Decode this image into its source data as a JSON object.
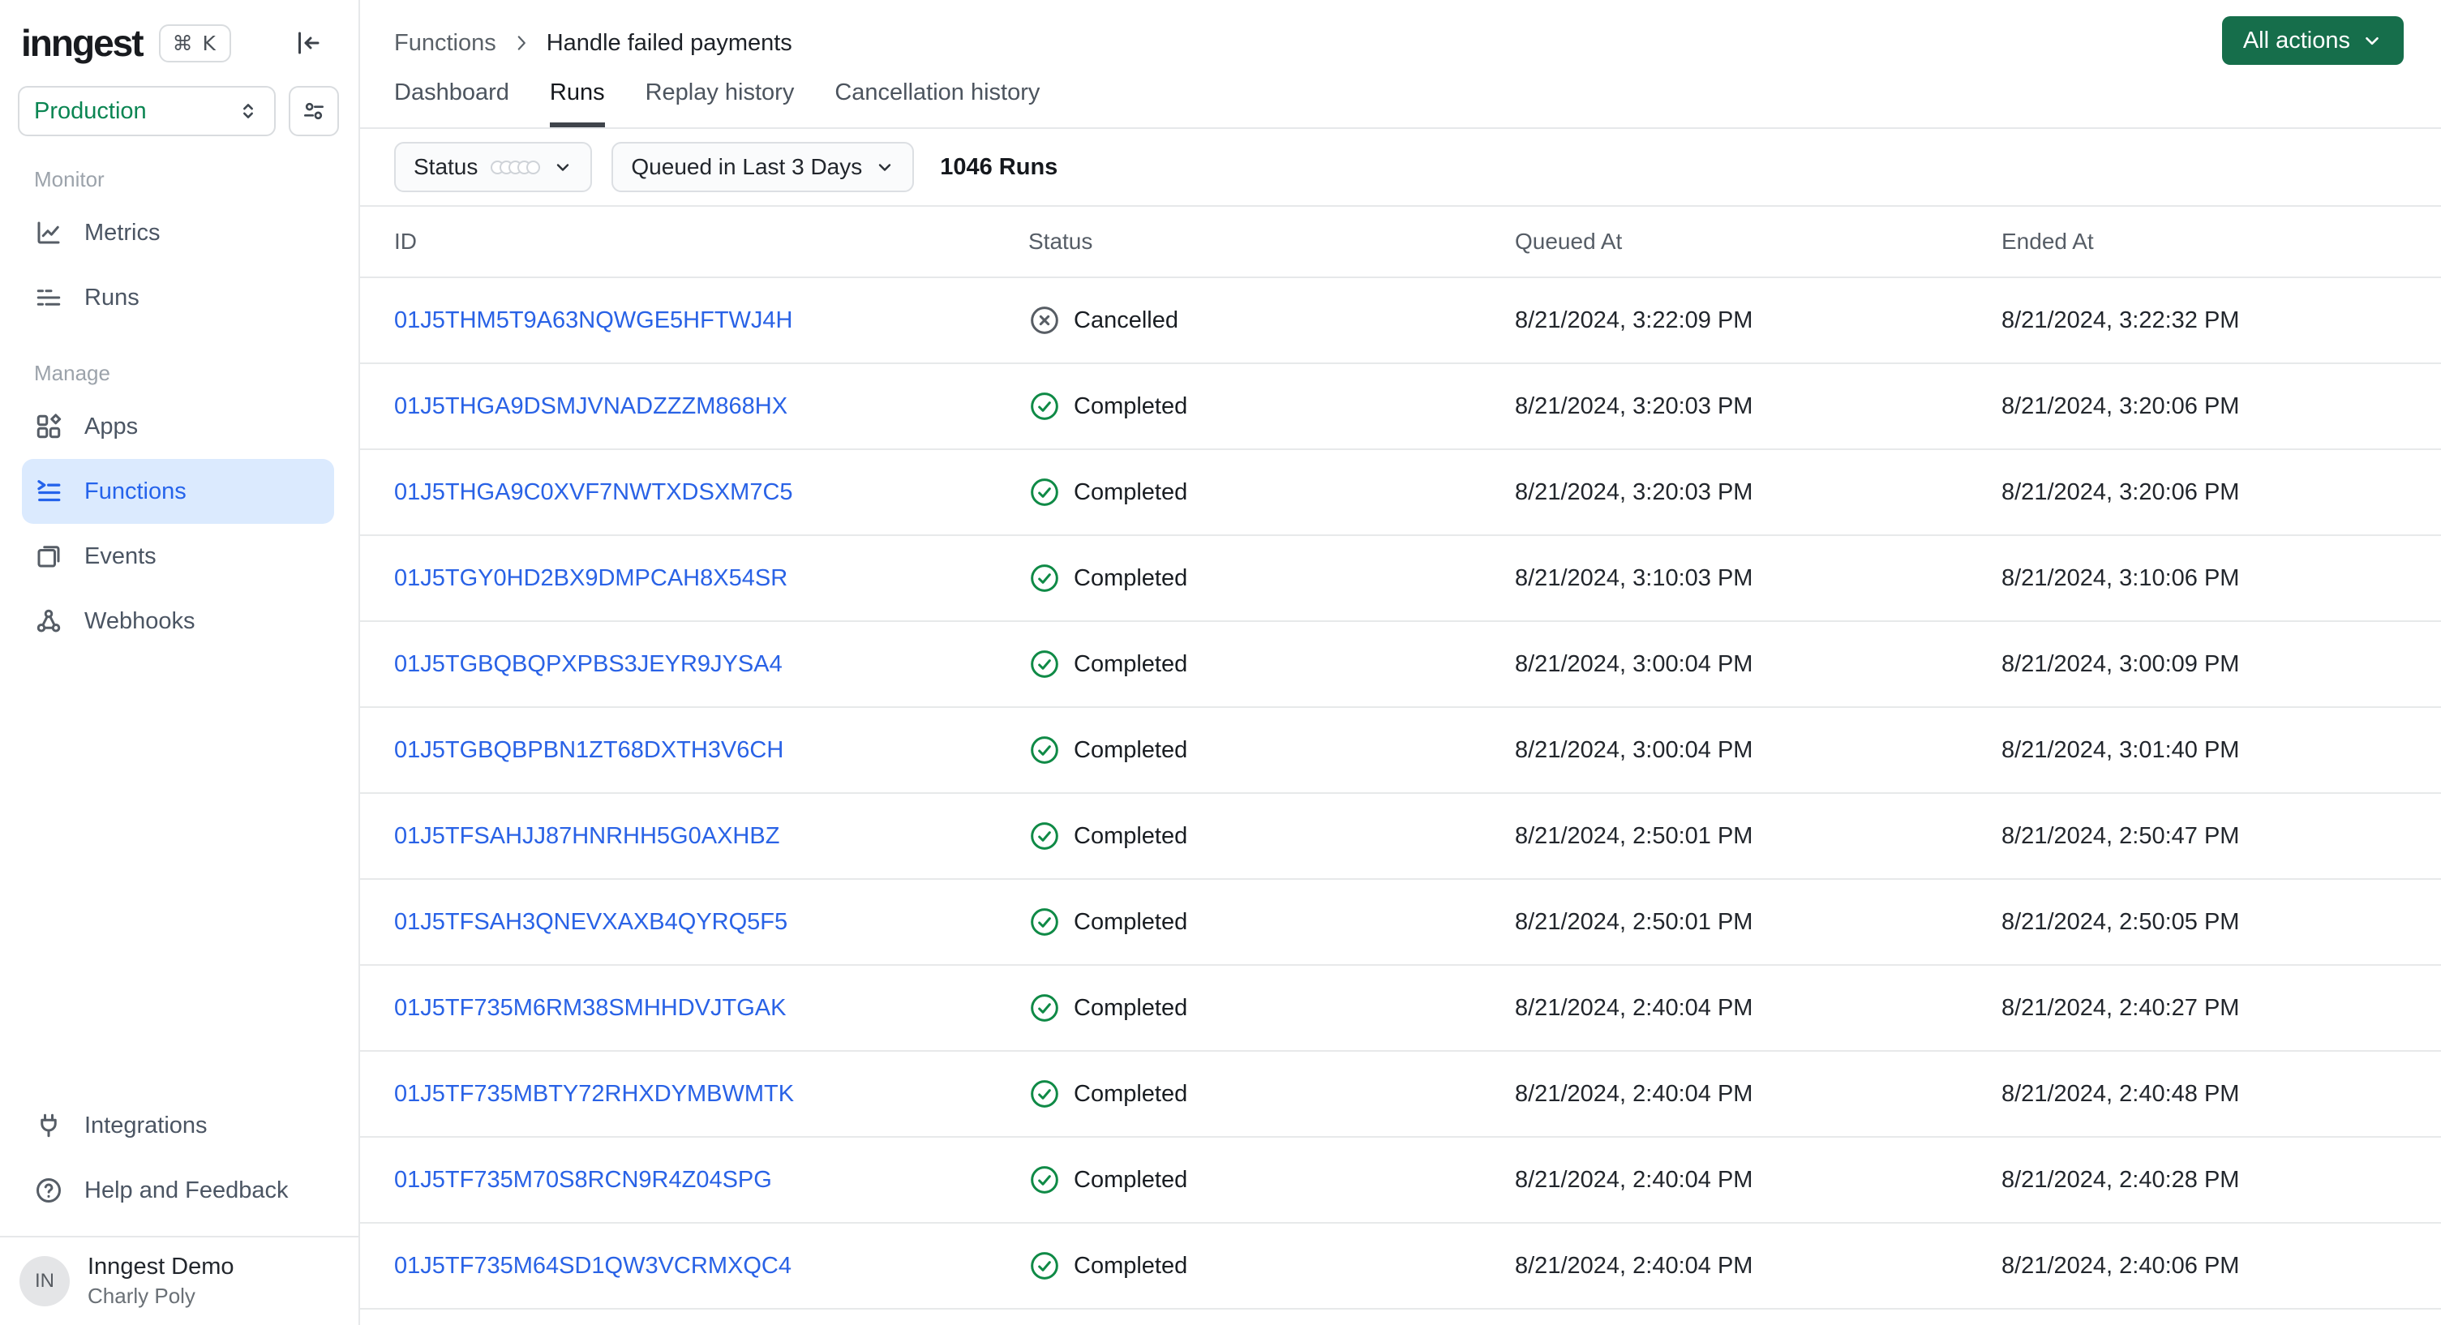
{
  "app": {
    "logo_text": "inngest",
    "keyboard_shortcut": "⌘ K"
  },
  "colors": {
    "accent_green": "#166e4b",
    "environment_green": "#0a8552",
    "link_blue": "#2962e6",
    "active_nav_blue": "#2563eb",
    "active_nav_bg": "#dbeafe",
    "completed_green": "#0f8a46",
    "cancelled_gray": "#575d64"
  },
  "icons": {
    "collapse-sidebar-icon": "panel collapse arrow",
    "env-updown-icon": "select up/down chevrons",
    "env-settings-icon": "sliders",
    "metrics-icon": "line chart",
    "runs-icon": "list",
    "apps-icon": "shapes grid",
    "functions-icon": "chevron list",
    "events-icon": "overlapping squares",
    "webhooks-icon": "node triangle",
    "integrations-icon": "plug",
    "help-icon": "question circle",
    "chevron-down-icon": "chevron down",
    "breadcrumb-chevron-icon": "chevron right",
    "completed-icon": "check in circle",
    "cancelled-icon": "x in circle",
    "status-rings-icon": "five overlapping rings"
  },
  "sidebar": {
    "environment": "Production",
    "monitor": {
      "label": "Monitor",
      "items": [
        {
          "label": "Metrics"
        },
        {
          "label": "Runs"
        }
      ]
    },
    "manage": {
      "label": "Manage",
      "items": [
        {
          "label": "Apps"
        },
        {
          "label": "Functions"
        },
        {
          "label": "Events"
        },
        {
          "label": "Webhooks"
        }
      ]
    },
    "footer": {
      "integrations": "Integrations",
      "help": "Help and Feedback"
    },
    "user": {
      "initials": "IN",
      "org": "Inngest Demo",
      "name": "Charly Poly"
    }
  },
  "header": {
    "breadcrumb": {
      "root": "Functions",
      "current": "Handle failed payments"
    },
    "tabs": [
      {
        "label": "Dashboard"
      },
      {
        "label": "Runs"
      },
      {
        "label": "Replay history"
      },
      {
        "label": "Cancellation history"
      }
    ],
    "actions_button": "All actions"
  },
  "filters": {
    "status_label": "Status",
    "time_range": "Queued in Last 3 Days",
    "runs_count": "1046 Runs"
  },
  "table": {
    "columns": [
      "ID",
      "Status",
      "Queued At",
      "Ended At"
    ],
    "rows": [
      {
        "id": "01J5THM5T9A63NQWGE5HFTWJ4H",
        "status": "Cancelled",
        "queued_at": "8/21/2024, 3:22:09 PM",
        "ended_at": "8/21/2024, 3:22:32 PM"
      },
      {
        "id": "01J5THGA9DSMJVNADZZZM868HX",
        "status": "Completed",
        "queued_at": "8/21/2024, 3:20:03 PM",
        "ended_at": "8/21/2024, 3:20:06 PM"
      },
      {
        "id": "01J5THGA9C0XVF7NWTXDSXM7C5",
        "status": "Completed",
        "queued_at": "8/21/2024, 3:20:03 PM",
        "ended_at": "8/21/2024, 3:20:06 PM"
      },
      {
        "id": "01J5TGY0HD2BX9DMPCAH8X54SR",
        "status": "Completed",
        "queued_at": "8/21/2024, 3:10:03 PM",
        "ended_at": "8/21/2024, 3:10:06 PM"
      },
      {
        "id": "01J5TGBQBQPXPBS3JEYR9JYSA4",
        "status": "Completed",
        "queued_at": "8/21/2024, 3:00:04 PM",
        "ended_at": "8/21/2024, 3:00:09 PM"
      },
      {
        "id": "01J5TGBQBPBN1ZT68DXTH3V6CH",
        "status": "Completed",
        "queued_at": "8/21/2024, 3:00:04 PM",
        "ended_at": "8/21/2024, 3:01:40 PM"
      },
      {
        "id": "01J5TFSAHJJ87HNRHH5G0AXHBZ",
        "status": "Completed",
        "queued_at": "8/21/2024, 2:50:01 PM",
        "ended_at": "8/21/2024, 2:50:47 PM"
      },
      {
        "id": "01J5TFSAH3QNEVXAXB4QYRQ5F5",
        "status": "Completed",
        "queued_at": "8/21/2024, 2:50:01 PM",
        "ended_at": "8/21/2024, 2:50:05 PM"
      },
      {
        "id": "01J5TF735M6RM38SMHHDVJTGAK",
        "status": "Completed",
        "queued_at": "8/21/2024, 2:40:04 PM",
        "ended_at": "8/21/2024, 2:40:27 PM"
      },
      {
        "id": "01J5TF735MBTY72RHXDYMBWMTK",
        "status": "Completed",
        "queued_at": "8/21/2024, 2:40:04 PM",
        "ended_at": "8/21/2024, 2:40:48 PM"
      },
      {
        "id": "01J5TF735M70S8RCN9R4Z04SPG",
        "status": "Completed",
        "queued_at": "8/21/2024, 2:40:04 PM",
        "ended_at": "8/21/2024, 2:40:28 PM"
      },
      {
        "id": "01J5TF735M64SD1QW3VCRMXQC4",
        "status": "Completed",
        "queued_at": "8/21/2024, 2:40:04 PM",
        "ended_at": "8/21/2024, 2:40:06 PM"
      }
    ]
  }
}
